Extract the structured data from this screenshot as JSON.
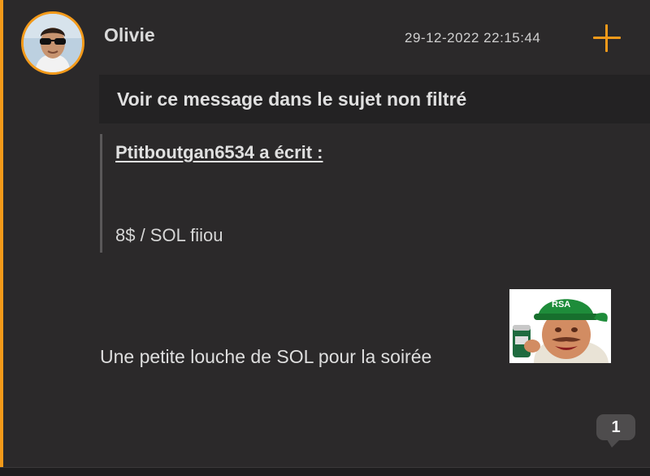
{
  "post": {
    "author": "Olivie",
    "timestamp": "29-12-2022 22:15:44",
    "unfiltered_link": "Voir ce message dans le sujet non filtré",
    "quote": {
      "author_line": "Ptitboutgan6534 a écrit :",
      "text": "8$ / SOL fiiou"
    },
    "message": "Une petite louche de SOL pour la soirée",
    "sticker_caption": "RSA",
    "reply_count": "1"
  },
  "colors": {
    "accent": "#f39a1a",
    "background": "#2b292a",
    "bar": "#232223"
  },
  "icons": {
    "plus": "plus-icon",
    "reply": "speech-bubble-icon"
  }
}
